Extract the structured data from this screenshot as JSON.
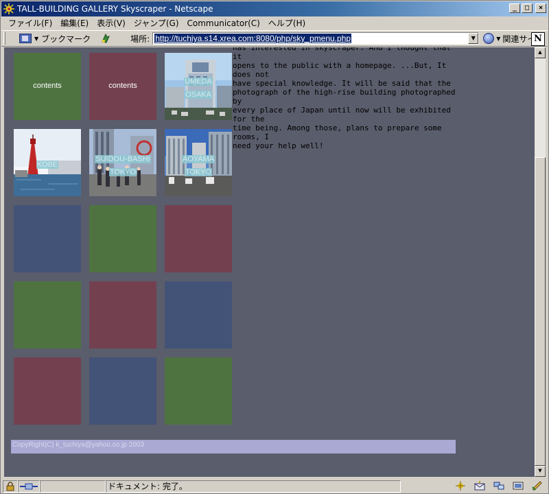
{
  "window": {
    "title": "TALL-BUILDING GALLERY Skyscraper - Netscape"
  },
  "menu": [
    "ファイル(F)",
    "編集(E)",
    "表示(V)",
    "ジャンプ(G)",
    "Communicator(C)",
    "ヘルプ(H)"
  ],
  "toolbar": {
    "bookmarks_label": "ブックマーク",
    "location_label": "場所:",
    "url": "http://tuchiya.s14.xrea.com:8080/php/sky_pmenu.php",
    "related_label": "関連サイト",
    "brand_letter": "N"
  },
  "gallery": {
    "contents_label": "contents",
    "umeda": [
      "UMEDA",
      "OSAKA"
    ],
    "kobe": [
      "KOBE"
    ],
    "suidoubashi": [
      "SUIDOU-BASHI",
      "TOKYO"
    ],
    "aoyama": [
      "AOYAMA",
      "TOKYO"
    ]
  },
  "intro_lines": [
    "has interested in skyscraper. And I thought that it",
    "opens to the public with a homepage. ...But, It does not",
    "have special knowledge. It will be said that the",
    "photograph of the high-rise building photographed by",
    "every place of Japan until now will be exhibited for the",
    "time being. Among those, plans to prepare some rooms, I",
    "need your help well!"
  ],
  "footer": "CopyRight(C) k_tuchiya@yahoo.co.jp 2003",
  "status": {
    "text": "ドキュメント: 完了。"
  },
  "colors": {
    "page_bg": "#5a5d6b",
    "tile_green": "#4e7341",
    "tile_red": "#73404f",
    "tile_blue": "#435377",
    "footer_bg": "#a9a9d4"
  }
}
